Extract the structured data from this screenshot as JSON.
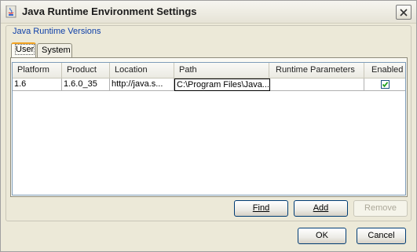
{
  "window": {
    "title": "Java Runtime Environment Settings"
  },
  "group": {
    "label": "Java Runtime Versions"
  },
  "tabs": [
    {
      "label": "User",
      "active": true
    },
    {
      "label": "System",
      "active": false
    }
  ],
  "table": {
    "columns": [
      "Platform",
      "Product",
      "Location",
      "Path",
      "Runtime Parameters",
      "Enabled"
    ],
    "rows": [
      {
        "platform": "1.6",
        "product": "1.6.0_35",
        "location": "http://java.s...",
        "path": "C:\\Program Files\\Java...",
        "runtime_parameters": "",
        "enabled": true
      }
    ]
  },
  "buttons": {
    "find": "Find",
    "add": "Add",
    "remove": "Remove",
    "ok": "OK",
    "cancel": "Cancel"
  },
  "colors": {
    "accent_tab": "#f2a322",
    "group_label": "#0e3fa8",
    "check": "#21a121"
  }
}
